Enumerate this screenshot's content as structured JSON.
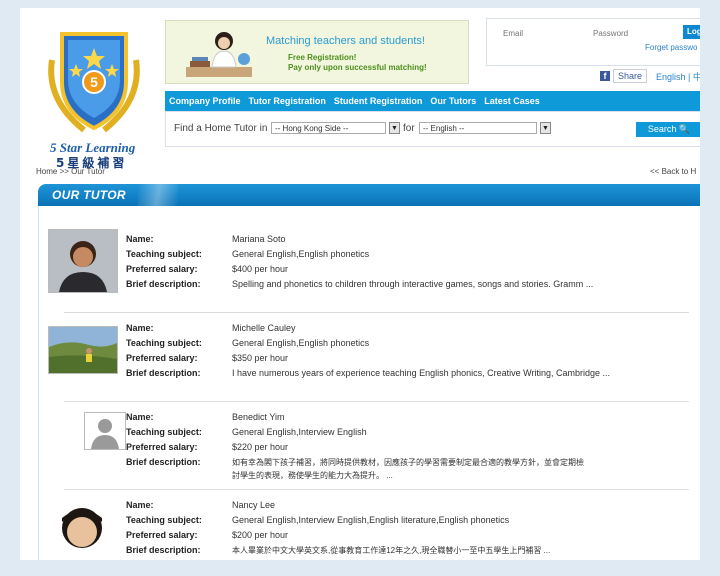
{
  "brand": {
    "name_en": "5 Star Learning",
    "name_zh": "5星級補習",
    "badge": "5"
  },
  "banner": {
    "title": "Matching teachers and students!",
    "line1": "Free Registration!",
    "line2": "Pay only upon successful matching!"
  },
  "login": {
    "email_placeholder": "Email",
    "password_placeholder": "Password",
    "login_label": "Log",
    "forgot_label": "Forget passwo"
  },
  "share": {
    "label": "Share",
    "lang": "English | 中"
  },
  "nav": {
    "items": [
      {
        "label": "Company Profile"
      },
      {
        "label": "Tutor Registration"
      },
      {
        "label": "Student Registration"
      },
      {
        "label": "Our Tutors"
      },
      {
        "label": "Latest Cases"
      }
    ]
  },
  "search": {
    "prompt": "Find a Home Tutor in",
    "region": "-- Hong Kong Side --",
    "for_label": "for",
    "subject": "-- English --",
    "button": "Search"
  },
  "breadcrumb": "Home >> Our Tutor",
  "back_label": "<< Back to H",
  "section_title": "OUR TUTOR",
  "field_labels": {
    "name": "Name:",
    "subject": "Teaching subject:",
    "salary": "Preferred salary:",
    "desc": "Brief description:"
  },
  "tutors": [
    {
      "name": "Mariana Soto",
      "subject": "General English,English phonetics",
      "salary": "$400 per hour",
      "desc": "Spelling and phonetics to children through interactive games, songs and stories. Gramm ..."
    },
    {
      "name": "Michelle Cauley",
      "subject": "General English,English phonetics",
      "salary": "$350 per hour",
      "desc": "I have numerous years of experience teaching English phonics, Creative Writing, Cambridge ..."
    },
    {
      "name": "Benedict Yim",
      "subject": "General English,Interview English",
      "salary": "$220 per hour",
      "desc": "如有幸為閣下孩子補習，將同時提供教材，因應孩子的學習需要制定最合適的教學方針，並會定期檢",
      "desc2": "討學生的表現，務使學生的能力大為提升。 ..."
    },
    {
      "name": "Nancy Lee",
      "subject": "General English,Interview English,English literature,English phonetics",
      "salary": "$200 per hour",
      "desc": "本人畢業於中文大學英文系,從事教育工作達12年之久,現全職替小一至中五學生上門補習 ..."
    }
  ],
  "colors": {
    "accent": "#0e99d8",
    "banner_bg": "#f2f6df",
    "page_bg": "#dfeaf2"
  }
}
